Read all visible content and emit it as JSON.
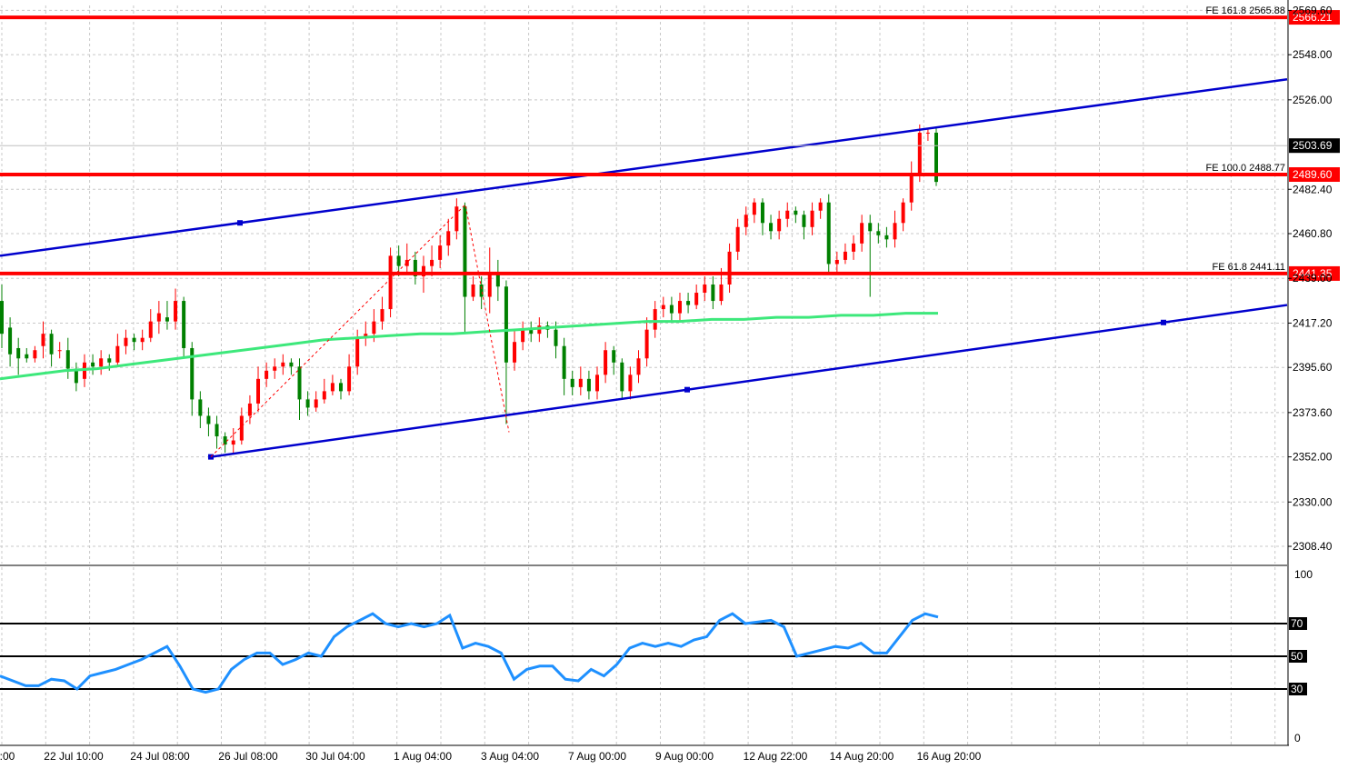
{
  "chart_data": [
    {
      "type": "candlestick",
      "x_labels": [
        ":00",
        "22 Jul 10:00",
        "24 Jul 08:00",
        "26 Jul 08:00",
        "30 Jul 04:00",
        "1 Aug 04:00",
        "3 Aug 04:00",
        "7 Aug 00:00",
        "9 Aug 00:00",
        "12 Aug 22:00",
        "14 Aug 20:00",
        "16 Aug 20:00"
      ],
      "y_tick_labels": [
        "2569.60",
        "2548.00",
        "2526.00",
        "2482.40",
        "2460.80",
        "2439.00",
        "2417.20",
        "2395.60",
        "2373.60",
        "2352.00",
        "2330.00",
        "2308.40"
      ],
      "ylim": [
        2300,
        2572
      ],
      "colors": {
        "up": "#ff0000",
        "down": "#008000",
        "ma": "#3de87b",
        "channel": "#0000cd",
        "level": "#ff0000"
      },
      "candles": [
        [
          2428,
          2412,
          2436,
          2405
        ],
        [
          2415,
          2402,
          2420,
          2396
        ],
        [
          2405,
          2400,
          2410,
          2392
        ],
        [
          2402,
          2400,
          2405,
          2398
        ],
        [
          2400,
          2404,
          2406,
          2398
        ],
        [
          2406,
          2412,
          2418,
          2400
        ],
        [
          2412,
          2402,
          2414,
          2396
        ],
        [
          2404,
          2404,
          2408,
          2400
        ],
        [
          2404,
          2395,
          2410,
          2390
        ],
        [
          2395,
          2388,
          2398,
          2384
        ],
        [
          2390,
          2398,
          2402,
          2386
        ],
        [
          2398,
          2396,
          2402,
          2392
        ],
        [
          2396,
          2400,
          2404,
          2392
        ],
        [
          2400,
          2398,
          2402,
          2394
        ],
        [
          2398,
          2406,
          2412,
          2396
        ],
        [
          2406,
          2410,
          2414,
          2402
        ],
        [
          2410,
          2408,
          2412,
          2404
        ],
        [
          2408,
          2410,
          2414,
          2404
        ],
        [
          2410,
          2418,
          2424,
          2408
        ],
        [
          2418,
          2422,
          2428,
          2412
        ],
        [
          2420,
          2418,
          2428,
          2414
        ],
        [
          2418,
          2428,
          2434,
          2414
        ],
        [
          2428,
          2405,
          2430,
          2400
        ],
        [
          2405,
          2380,
          2408,
          2372
        ],
        [
          2380,
          2372,
          2384,
          2366
        ],
        [
          2372,
          2368,
          2376,
          2362
        ],
        [
          2368,
          2362,
          2372,
          2356
        ],
        [
          2362,
          2358,
          2364,
          2354
        ],
        [
          2358,
          2360,
          2366,
          2354
        ],
        [
          2360,
          2372,
          2376,
          2358
        ],
        [
          2372,
          2378,
          2382,
          2368
        ],
        [
          2378,
          2390,
          2396,
          2374
        ],
        [
          2390,
          2394,
          2398,
          2386
        ],
        [
          2394,
          2396,
          2400,
          2390
        ],
        [
          2396,
          2398,
          2402,
          2392
        ],
        [
          2398,
          2396,
          2400,
          2392
        ],
        [
          2396,
          2380,
          2400,
          2370
        ],
        [
          2380,
          2376,
          2384,
          2372
        ],
        [
          2376,
          2380,
          2384,
          2374
        ],
        [
          2380,
          2384,
          2390,
          2378
        ],
        [
          2384,
          2388,
          2392,
          2382
        ],
        [
          2388,
          2384,
          2390,
          2380
        ],
        [
          2384,
          2396,
          2402,
          2382
        ],
        [
          2396,
          2410,
          2414,
          2392
        ],
        [
          2410,
          2412,
          2418,
          2406
        ],
        [
          2412,
          2418,
          2424,
          2408
        ],
        [
          2418,
          2424,
          2430,
          2414
        ],
        [
          2424,
          2450,
          2454,
          2420
        ],
        [
          2450,
          2445,
          2455,
          2440
        ],
        [
          2445,
          2448,
          2456,
          2442
        ],
        [
          2448,
          2440,
          2452,
          2436
        ],
        [
          2440,
          2445,
          2450,
          2432
        ],
        [
          2445,
          2448,
          2455,
          2440
        ],
        [
          2448,
          2455,
          2460,
          2444
        ],
        [
          2455,
          2462,
          2468,
          2450
        ],
        [
          2462,
          2474,
          2478,
          2458
        ],
        [
          2474,
          2430,
          2476,
          2412
        ],
        [
          2430,
          2436,
          2440,
          2428
        ],
        [
          2436,
          2430,
          2440,
          2424
        ],
        [
          2430,
          2442,
          2454,
          2422
        ],
        [
          2442,
          2435,
          2448,
          2428
        ],
        [
          2435,
          2398,
          2438,
          2368
        ],
        [
          2398,
          2408,
          2414,
          2394
        ],
        [
          2408,
          2414,
          2418,
          2404
        ],
        [
          2414,
          2412,
          2418,
          2408
        ],
        [
          2412,
          2416,
          2420,
          2408
        ],
        [
          2416,
          2414,
          2418,
          2410
        ],
        [
          2414,
          2406,
          2418,
          2400
        ],
        [
          2406,
          2390,
          2410,
          2382
        ],
        [
          2390,
          2386,
          2394,
          2382
        ],
        [
          2386,
          2390,
          2396,
          2382
        ],
        [
          2390,
          2384,
          2394,
          2380
        ],
        [
          2384,
          2392,
          2396,
          2380
        ],
        [
          2392,
          2404,
          2408,
          2388
        ],
        [
          2404,
          2398,
          2406,
          2392
        ],
        [
          2398,
          2384,
          2400,
          2380
        ],
        [
          2384,
          2392,
          2396,
          2380
        ],
        [
          2392,
          2400,
          2404,
          2388
        ],
        [
          2400,
          2414,
          2420,
          2396
        ],
        [
          2414,
          2424,
          2428,
          2410
        ],
        [
          2424,
          2426,
          2430,
          2420
        ],
        [
          2426,
          2422,
          2430,
          2418
        ],
        [
          2422,
          2428,
          2432,
          2418
        ],
        [
          2428,
          2426,
          2432,
          2422
        ],
        [
          2426,
          2432,
          2436,
          2424
        ],
        [
          2432,
          2436,
          2440,
          2428
        ],
        [
          2436,
          2428,
          2440,
          2424
        ],
        [
          2428,
          2436,
          2444,
          2426
        ],
        [
          2436,
          2452,
          2456,
          2432
        ],
        [
          2452,
          2464,
          2468,
          2448
        ],
        [
          2464,
          2470,
          2474,
          2460
        ],
        [
          2470,
          2476,
          2478,
          2466
        ],
        [
          2476,
          2466,
          2478,
          2460
        ],
        [
          2466,
          2462,
          2470,
          2458
        ],
        [
          2462,
          2468,
          2472,
          2458
        ],
        [
          2468,
          2472,
          2476,
          2464
        ],
        [
          2472,
          2470,
          2474,
          2466
        ],
        [
          2470,
          2464,
          2472,
          2458
        ],
        [
          2464,
          2472,
          2476,
          2460
        ],
        [
          2472,
          2476,
          2478,
          2468
        ],
        [
          2476,
          2446,
          2480,
          2442
        ],
        [
          2446,
          2448,
          2452,
          2442
        ],
        [
          2448,
          2452,
          2456,
          2446
        ],
        [
          2452,
          2456,
          2460,
          2448
        ],
        [
          2456,
          2466,
          2470,
          2452
        ],
        [
          2466,
          2462,
          2470,
          2430
        ],
        [
          2462,
          2460,
          2466,
          2456
        ],
        [
          2460,
          2458,
          2464,
          2454
        ],
        [
          2458,
          2466,
          2472,
          2454
        ],
        [
          2466,
          2476,
          2478,
          2462
        ],
        [
          2476,
          2490,
          2496,
          2472
        ],
        [
          2490,
          2510,
          2514,
          2486
        ],
        [
          2510,
          2510,
          2512,
          2506
        ],
        [
          2510,
          2486,
          2512,
          2484
        ]
      ],
      "ma": [
        2390,
        2392,
        2394,
        2395,
        2397,
        2399,
        2401,
        2403,
        2405,
        2407,
        2409,
        2410,
        2411,
        2412,
        2412,
        2413,
        2414,
        2415,
        2416,
        2417,
        2418,
        2418,
        2419,
        2419,
        2420,
        2420,
        2421,
        2421,
        2422,
        2422
      ],
      "channel": {
        "upper_start": 2450,
        "upper_end": 2536,
        "lower_start": 2352,
        "lower_end": 2426
      },
      "levels": [
        {
          "value": 2566.21,
          "label": "FE 161.8 2565.88",
          "tag": "2566.21"
        },
        {
          "value": 2489.6,
          "label": "FE 100.0 2488.77",
          "tag": "2489.60"
        },
        {
          "value": 2441.35,
          "label": "FE 61.8 2441.11",
          "tag": "2441.35"
        }
      ],
      "current_price": "2503.69"
    },
    {
      "type": "line",
      "y_tick_labels": [
        "100",
        "70",
        "50",
        "30",
        "0"
      ],
      "ylim": [
        0,
        100
      ],
      "levels": [
        70,
        50,
        30
      ],
      "colors": {
        "line": "#1e90ff"
      },
      "values": [
        38,
        35,
        32,
        32,
        36,
        35,
        30,
        38,
        40,
        42,
        45,
        48,
        52,
        56,
        44,
        30,
        28,
        30,
        42,
        48,
        52,
        52,
        45,
        48,
        52,
        50,
        62,
        68,
        72,
        76,
        70,
        68,
        70,
        68,
        70,
        75,
        55,
        58,
        56,
        52,
        36,
        42,
        44,
        44,
        36,
        35,
        42,
        38,
        45,
        55,
        58,
        56,
        58,
        56,
        60,
        62,
        72,
        76,
        70,
        71,
        72,
        68,
        50,
        52,
        54,
        56,
        55,
        58,
        52,
        52,
        62,
        72,
        76,
        74
      ]
    }
  ]
}
